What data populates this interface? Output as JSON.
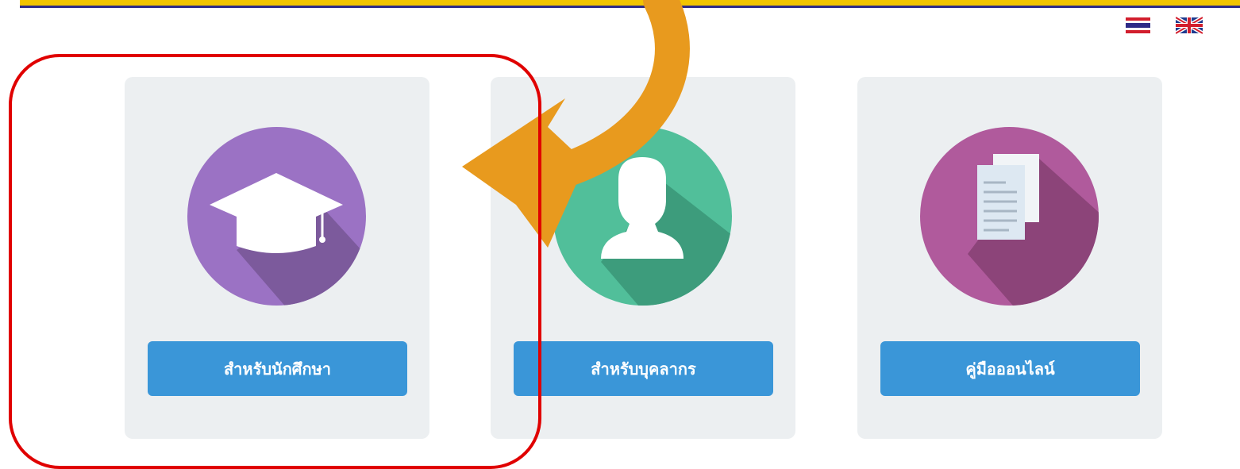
{
  "header": {
    "accent_color": "#f2c400",
    "border_color": "#2d2a87"
  },
  "languages": [
    {
      "name": "thai-flag-icon",
      "label": "TH"
    },
    {
      "name": "uk-flag-icon",
      "label": "EN"
    }
  ],
  "cards": [
    {
      "icon": "graduation-cap-icon",
      "color": "#9b72c4",
      "button_label": "สำหรับนักศึกษา"
    },
    {
      "icon": "person-icon",
      "color": "#51bf9a",
      "button_label": "สำหรับบุคลากร"
    },
    {
      "icon": "documents-icon",
      "color": "#b05a9c",
      "button_label": "คู่มือออนไลน์"
    }
  ],
  "annotations": {
    "highlight_color": "#e00000",
    "arrow_color": "#e89a1e"
  }
}
